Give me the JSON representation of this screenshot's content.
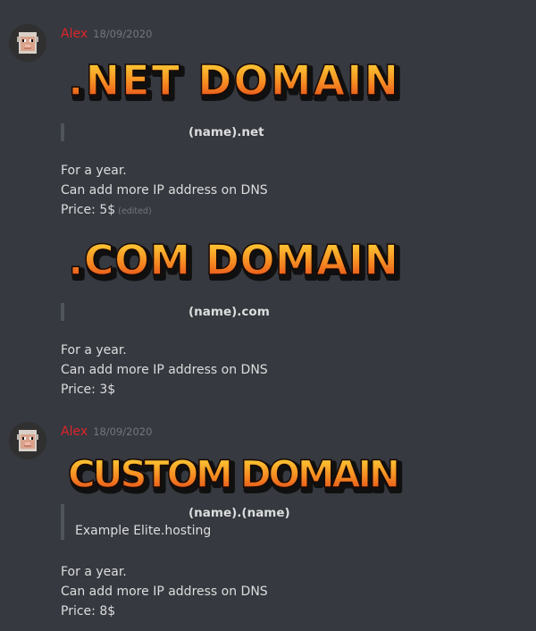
{
  "messages": [
    {
      "author": "Alex",
      "timestamp": "18/09/2020",
      "blocks": [
        {
          "banner": ".NET DOMAIN",
          "quote_title": "(name).net",
          "lines": [
            "For a year.",
            "Can add more IP address on DNS",
            "Price: 5$"
          ],
          "edited": "(edited)"
        },
        {
          "banner": ".COM DOMAIN",
          "quote_title": "(name).com",
          "lines": [
            "For a year.",
            "Can add more IP address on DNS",
            "Price: 3$"
          ]
        }
      ]
    },
    {
      "author": "Alex",
      "timestamp": "18/09/2020",
      "blocks": [
        {
          "banner": "CUSTOM DOMAIN",
          "quote_title": "(name).(name)",
          "quote_desc": "Example Elite.hosting",
          "lines": [
            "For a year.",
            "Can add more IP address on DNS",
            "Price: 8$"
          ]
        }
      ]
    }
  ],
  "colors": {
    "background": "#36393f",
    "author": "#e0242a",
    "timestamp": "#72767d",
    "text": "#dcddde",
    "quote_bar": "#4f545c",
    "banner_top": "#ffd02a",
    "banner_bottom": "#e8461e"
  }
}
